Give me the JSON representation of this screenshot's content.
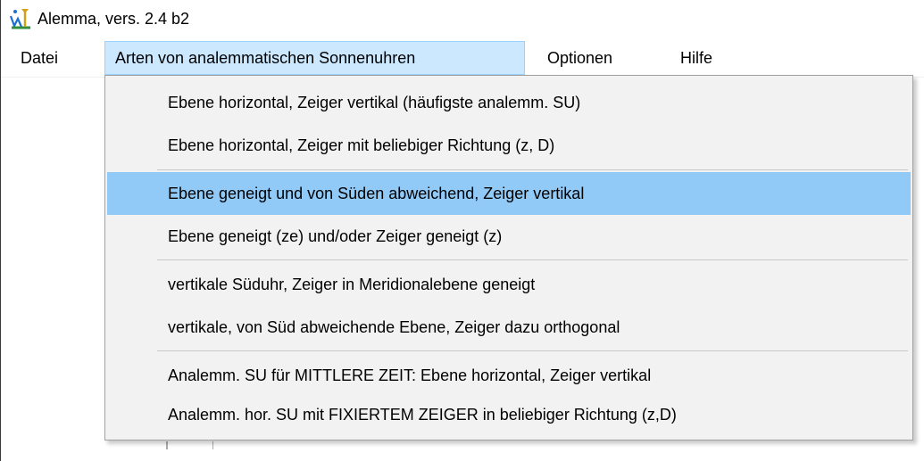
{
  "window": {
    "title": "Alemma,  vers. 2.4 b2",
    "icon": "alemma-app-icon"
  },
  "menubar": {
    "items": [
      {
        "label": "Datei"
      },
      {
        "label": "Arten von analemmatischen Sonnenuhren",
        "open": true
      },
      {
        "label": "Optionen"
      },
      {
        "label": "Hilfe"
      }
    ]
  },
  "dropdown": {
    "groups": [
      [
        "Ebene horizontal, Zeiger vertikal (häufigste analemm. SU)",
        "Ebene horizontal, Zeiger mit beliebiger Richtung (z, D)"
      ],
      [
        "Ebene geneigt und von Süden abweichend, Zeiger vertikal",
        "Ebene geneigt (ze) und/oder Zeiger geneigt (z)"
      ],
      [
        "vertikale Süduhr, Zeiger in Meridionalebene geneigt",
        "vertikale, von Süd abweichende Ebene, Zeiger dazu orthogonal"
      ],
      [
        "Analemm. SU für MITTLERE ZEIT: Ebene horizontal, Zeiger vertikal",
        "Analemm. hor. SU mit FIXIERTEM ZEIGER in beliebiger Richtung (z,D)"
      ]
    ],
    "highlighted_item": "Ebene geneigt und von Süden abweichend, Zeiger vertikal"
  },
  "colors": {
    "menu_open_bg": "#cce8ff",
    "menu_highlight_bg": "#91c9f7",
    "dropdown_bg": "#f2f2f2"
  }
}
